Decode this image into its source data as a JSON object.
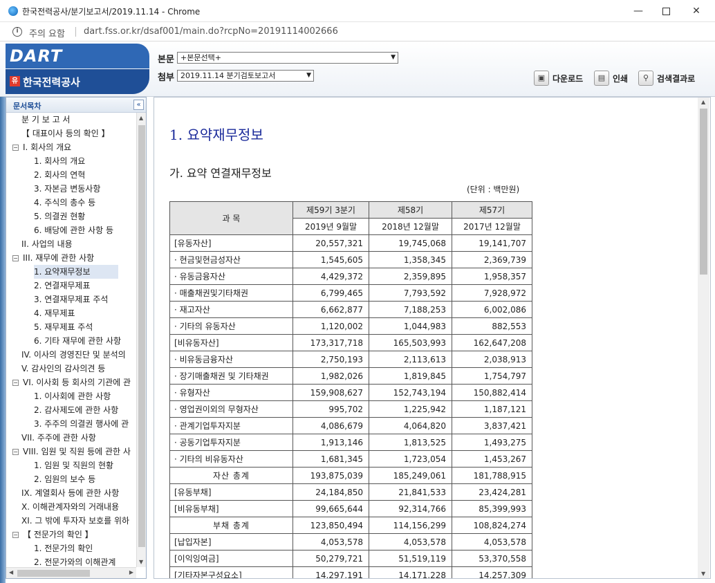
{
  "browser": {
    "window_title": "한국전력공사/분기보고서/2019.11.14 - Chrome",
    "security_label": "주의 요함",
    "url": "dart.fss.or.kr/dsaf001/main.do?rcpNo=20191114002666",
    "minimize": "—",
    "close": "✕"
  },
  "header": {
    "logo": "DART",
    "company_badge": "유",
    "company": "한국전력공사",
    "main_label": "본문",
    "main_select": "+본문선택+",
    "attach_label": "첨부",
    "attach_select": "2019.11.14   분기검토보고서",
    "buttons": {
      "download": "다운로드",
      "print": "인쇄",
      "search_results": "검색결과로"
    }
  },
  "toc": {
    "title": "문서목차",
    "collapse": "«",
    "items": [
      {
        "label": "분 기 보 고 서",
        "level": 1
      },
      {
        "label": "【 대표이사 등의 확인 】",
        "level": 1
      },
      {
        "label": "I. 회사의 개요",
        "level": 0
      },
      {
        "label": "1. 회사의 개요",
        "level": 2
      },
      {
        "label": "2. 회사의 연혁",
        "level": 2
      },
      {
        "label": "3. 자본금 변동사항",
        "level": 2
      },
      {
        "label": "4. 주식의 총수 등",
        "level": 2
      },
      {
        "label": "5. 의결권 현황",
        "level": 2
      },
      {
        "label": "6. 배당에 관한 사항 등",
        "level": 2
      },
      {
        "label": "II. 사업의 내용",
        "level": 1
      },
      {
        "label": "III. 재무에 관한 사항",
        "level": 0
      },
      {
        "label": "1. 요약재무정보",
        "level": 2
      },
      {
        "label": "2. 연결재무제표",
        "level": 2
      },
      {
        "label": "3. 연결재무제표 주석",
        "level": 2
      },
      {
        "label": "4. 재무제표",
        "level": 2
      },
      {
        "label": "5. 재무제표 주석",
        "level": 2
      },
      {
        "label": "6. 기타 재무에 관한 사항",
        "level": 2
      },
      {
        "label": "IV. 이사의 경영진단 및 분석의",
        "level": 1
      },
      {
        "label": "V. 감사인의 감사의견 등",
        "level": 1
      },
      {
        "label": "VI. 이사회 등 회사의 기관에 관",
        "level": 0
      },
      {
        "label": "1. 이사회에 관한 사항",
        "level": 2
      },
      {
        "label": "2. 감사제도에 관한 사항",
        "level": 2
      },
      {
        "label": "3. 주주의 의결권 행사에 관",
        "level": 2
      },
      {
        "label": "VII. 주주에 관한 사항",
        "level": 1
      },
      {
        "label": "VIII. 임원 및 직원 등에 관한 사",
        "level": 0
      },
      {
        "label": "1. 임원 및 직원의 현황",
        "level": 2
      },
      {
        "label": "2. 임원의 보수 등",
        "level": 2
      },
      {
        "label": "IX. 계열회사 등에 관한 사항",
        "level": 1
      },
      {
        "label": "X. 이해관계자와의 거래내용",
        "level": 1
      },
      {
        "label": "XI. 그 밖에 투자자 보호를 위하",
        "level": 1
      },
      {
        "label": "【 전문가의 확인 】",
        "level": 0
      },
      {
        "label": "1. 전문가의 확인",
        "level": 2
      },
      {
        "label": "2. 전문가와의 이해관계",
        "level": 2
      }
    ],
    "selected_index": 11
  },
  "document": {
    "heading": "1. 요약재무정보",
    "subheading": "가. 요약 연결재무정보",
    "unit": "(단위 : 백만원)",
    "table": {
      "headers": [
        "과     목",
        "제59기 3분기",
        "제58기",
        "제57기"
      ],
      "subheaders": [
        "",
        "2019년 9월말",
        "2018년 12월말",
        "2017년  12월말"
      ],
      "rows": [
        {
          "label": "[유동자산]",
          "type": "lbl",
          "values": [
            "20,557,321",
            "19,745,068",
            "19,141,707"
          ]
        },
        {
          "label": "· 현금및현금성자산",
          "type": "lbl",
          "values": [
            "1,545,605",
            "1,358,345",
            "2,369,739"
          ]
        },
        {
          "label": "· 유동금융자산",
          "type": "lbl",
          "values": [
            "4,429,372",
            "2,359,895",
            "1,958,357"
          ]
        },
        {
          "label": "· 매출채권및기타채권",
          "type": "lbl",
          "values": [
            "6,799,465",
            "7,793,592",
            "7,928,972"
          ]
        },
        {
          "label": "· 재고자산",
          "type": "lbl",
          "values": [
            "6,662,877",
            "7,188,253",
            "6,002,086"
          ]
        },
        {
          "label": "· 기타의 유동자산",
          "type": "lbl",
          "values": [
            "1,120,002",
            "1,044,983",
            "882,553"
          ]
        },
        {
          "label": "[비유동자산]",
          "type": "lbl",
          "values": [
            "173,317,718",
            "165,503,993",
            "162,647,208"
          ]
        },
        {
          "label": "· 비유동금융자산",
          "type": "lbl",
          "values": [
            "2,750,193",
            "2,113,613",
            "2,038,913"
          ]
        },
        {
          "label": "· 장기매출채권 및 기타채권",
          "type": "lbl",
          "values": [
            "1,982,026",
            "1,819,845",
            "1,754,797"
          ]
        },
        {
          "label": "· 유형자산",
          "type": "lbl",
          "values": [
            "159,908,627",
            "152,743,194",
            "150,882,414"
          ]
        },
        {
          "label": "· 영업권이외의 무형자산",
          "type": "lbl",
          "values": [
            "995,702",
            "1,225,942",
            "1,187,121"
          ]
        },
        {
          "label": "· 관계기업투자지분",
          "type": "lbl",
          "values": [
            "4,086,679",
            "4,064,820",
            "3,837,421"
          ]
        },
        {
          "label": "· 공동기업투자지분",
          "type": "lbl",
          "values": [
            "1,913,146",
            "1,813,525",
            "1,493,275"
          ]
        },
        {
          "label": "· 기타의 비유동자산",
          "type": "lbl",
          "values": [
            "1,681,345",
            "1,723,054",
            "1,453,267"
          ]
        },
        {
          "label": "자산  총계",
          "type": "total",
          "values": [
            "193,875,039",
            "185,249,061",
            "181,788,915"
          ]
        },
        {
          "label": "[유동부채]",
          "type": "lbl",
          "values": [
            "24,184,850",
            "21,841,533",
            "23,424,281"
          ]
        },
        {
          "label": "[비유동부채]",
          "type": "lbl",
          "values": [
            "99,665,644",
            "92,314,766",
            "85,399,993"
          ]
        },
        {
          "label": "부채  총계",
          "type": "total",
          "values": [
            "123,850,494",
            "114,156,299",
            "108,824,274"
          ]
        },
        {
          "label": "[납입자본]",
          "type": "lbl",
          "values": [
            "4,053,578",
            "4,053,578",
            "4,053,578"
          ]
        },
        {
          "label": "[이익잉여금]",
          "type": "lbl",
          "values": [
            "50,279,721",
            "51,519,119",
            "53,370,558"
          ]
        },
        {
          "label": "[기타자본구성요소]",
          "type": "lbl",
          "values": [
            "14,297,191",
            "14,171,228",
            "14,257,309"
          ]
        }
      ]
    }
  },
  "colors": {
    "brand_blue": "#2f68b5",
    "brand_dark": "#1f4f97",
    "heading_blue": "#1a2a9a"
  }
}
